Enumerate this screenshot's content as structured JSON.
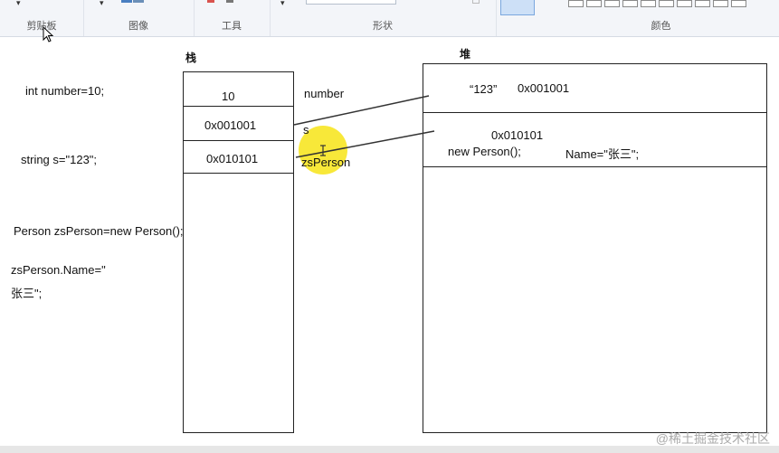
{
  "ribbon": {
    "groups": [
      "剪贴板",
      "图像",
      "工具",
      "形状",
      "颜色"
    ],
    "arrow_glyph": "▾"
  },
  "stack_title": "栈",
  "heap_title": "堆",
  "code": {
    "line1": "int number=10;",
    "line2": "string s=\"123\";",
    "line3": "Person zsPerson=new Person();",
    "line4a": "zsPerson.Name=\"",
    "line4b": "张三\";"
  },
  "stack_cells": [
    "10",
    "0x001001",
    "0x010101"
  ],
  "var_labels": [
    "number",
    "s",
    "zsPerson"
  ],
  "heap": {
    "string_value": "“123”",
    "string_addr": "0x001001",
    "obj_addr": "0x010101",
    "obj_new": "new Person();",
    "obj_name": "Name=\"张三\";"
  },
  "watermark": "@稀土掘金技术社区",
  "colors": {
    "highlight": "#f7e623",
    "ribbon_bg": "#f3f5f9"
  }
}
